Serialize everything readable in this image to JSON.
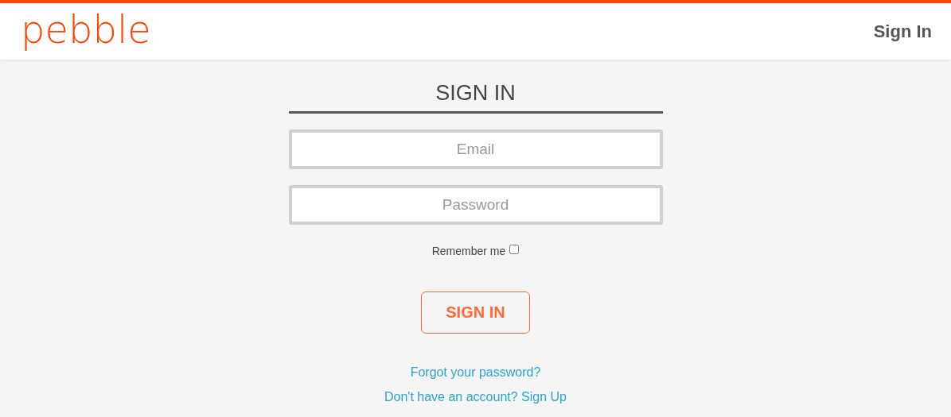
{
  "header": {
    "logo": "pebble",
    "nav_link": "Sign In"
  },
  "form": {
    "title": "SIGN IN",
    "fields": [
      {
        "placeholder": "Email"
      },
      {
        "placeholder": "Password"
      }
    ],
    "remember": {
      "label": "Remember me",
      "checked": false
    },
    "submit": "SIGN IN",
    "links": [
      "Forgot your password?",
      "Don't have an account? Sign Up"
    ]
  }
}
